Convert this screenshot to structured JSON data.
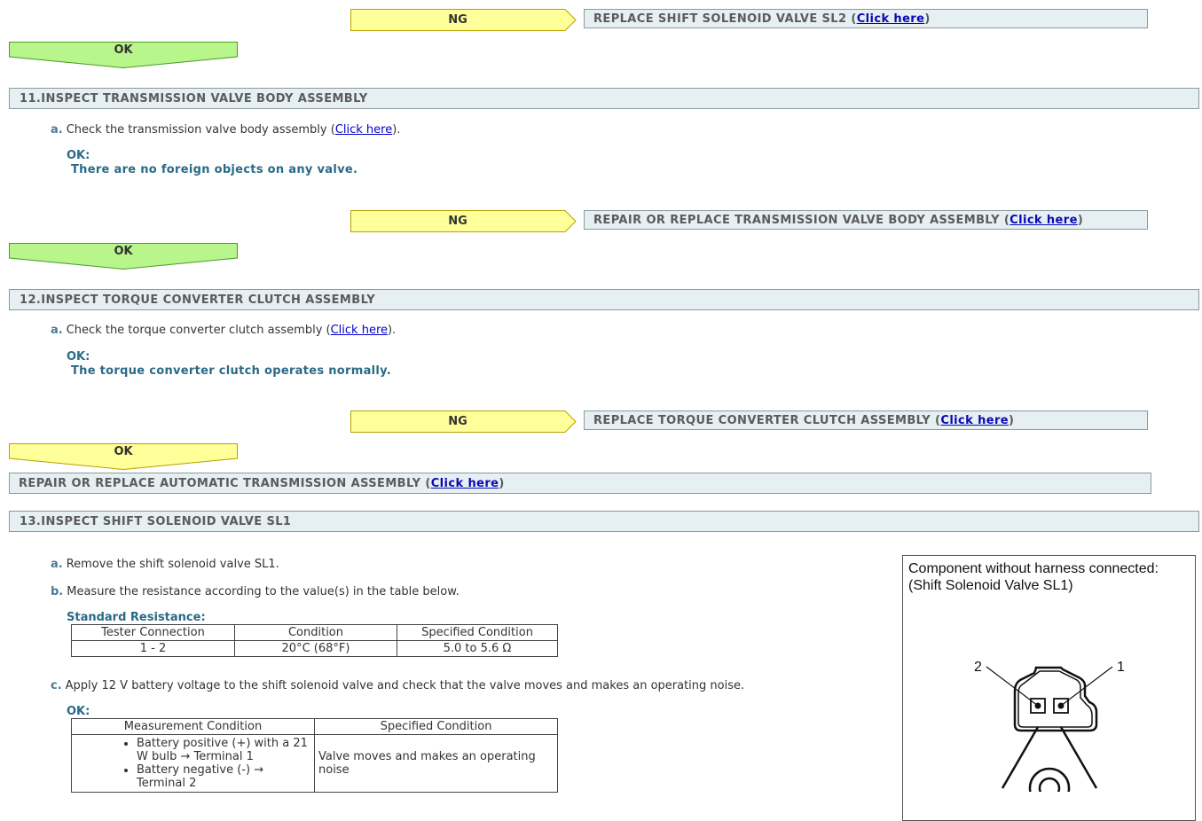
{
  "ng_label": "NG",
  "ok_label": "OK",
  "click_here": "Click here",
  "block1": {
    "ng_result": "REPLACE SHIFT SOLENOID VALVE SL2 ("
  },
  "section11": {
    "title": "11.INSPECT TRANSMISSION VALVE BODY ASSEMBLY",
    "step_a_letter": "a.",
    "step_a_text": "Check the transmission valve body assembly (",
    "ok_title": "OK:",
    "ok_desc": "There are no foreign objects on any valve.",
    "ng_result": "REPAIR OR REPLACE TRANSMISSION VALVE BODY ASSEMBLY ("
  },
  "section12": {
    "title": "12.INSPECT TORQUE CONVERTER CLUTCH ASSEMBLY",
    "step_a_letter": "a.",
    "step_a_text": "Check the torque converter clutch assembly (",
    "ok_title": "OK:",
    "ok_desc": "The torque converter clutch operates normally.",
    "ng_result": "REPLACE TORQUE CONVERTER CLUTCH ASSEMBLY ("
  },
  "final_result": "REPAIR OR REPLACE AUTOMATIC TRANSMISSION ASSEMBLY (",
  "section13": {
    "title": "13.INSPECT SHIFT SOLENOID VALVE SL1",
    "step_a_letter": "a.",
    "step_a_text": "Remove the shift solenoid valve SL1.",
    "step_b_letter": "b.",
    "step_b_text": "Measure the resistance according to the value(s) in the table below.",
    "std_resistance_title": "Standard Resistance:",
    "resistance_table": {
      "headers": [
        "Tester Connection",
        "Condition",
        "Specified Condition"
      ],
      "row": [
        "1 - 2",
        "20°C (68°F)",
        "5.0 to 5.6 Ω"
      ]
    },
    "step_c_letter": "c.",
    "step_c_text": "Apply 12 V battery voltage to the shift solenoid valve and check that the valve moves and makes an operating noise.",
    "ok_title": "OK:",
    "op_table": {
      "headers": [
        "Measurement Condition",
        "Specified Condition"
      ],
      "bullets": [
        "Battery positive (+) with a 21 W bulb → Terminal 1",
        "Battery negative (-) → Terminal 2"
      ],
      "result": "Valve moves and makes an operating noise"
    },
    "figure": {
      "caption_line1": "Component without harness connected:",
      "caption_line2": "(Shift Solenoid Valve SL1)",
      "pin1": "1",
      "pin2": "2"
    }
  }
}
